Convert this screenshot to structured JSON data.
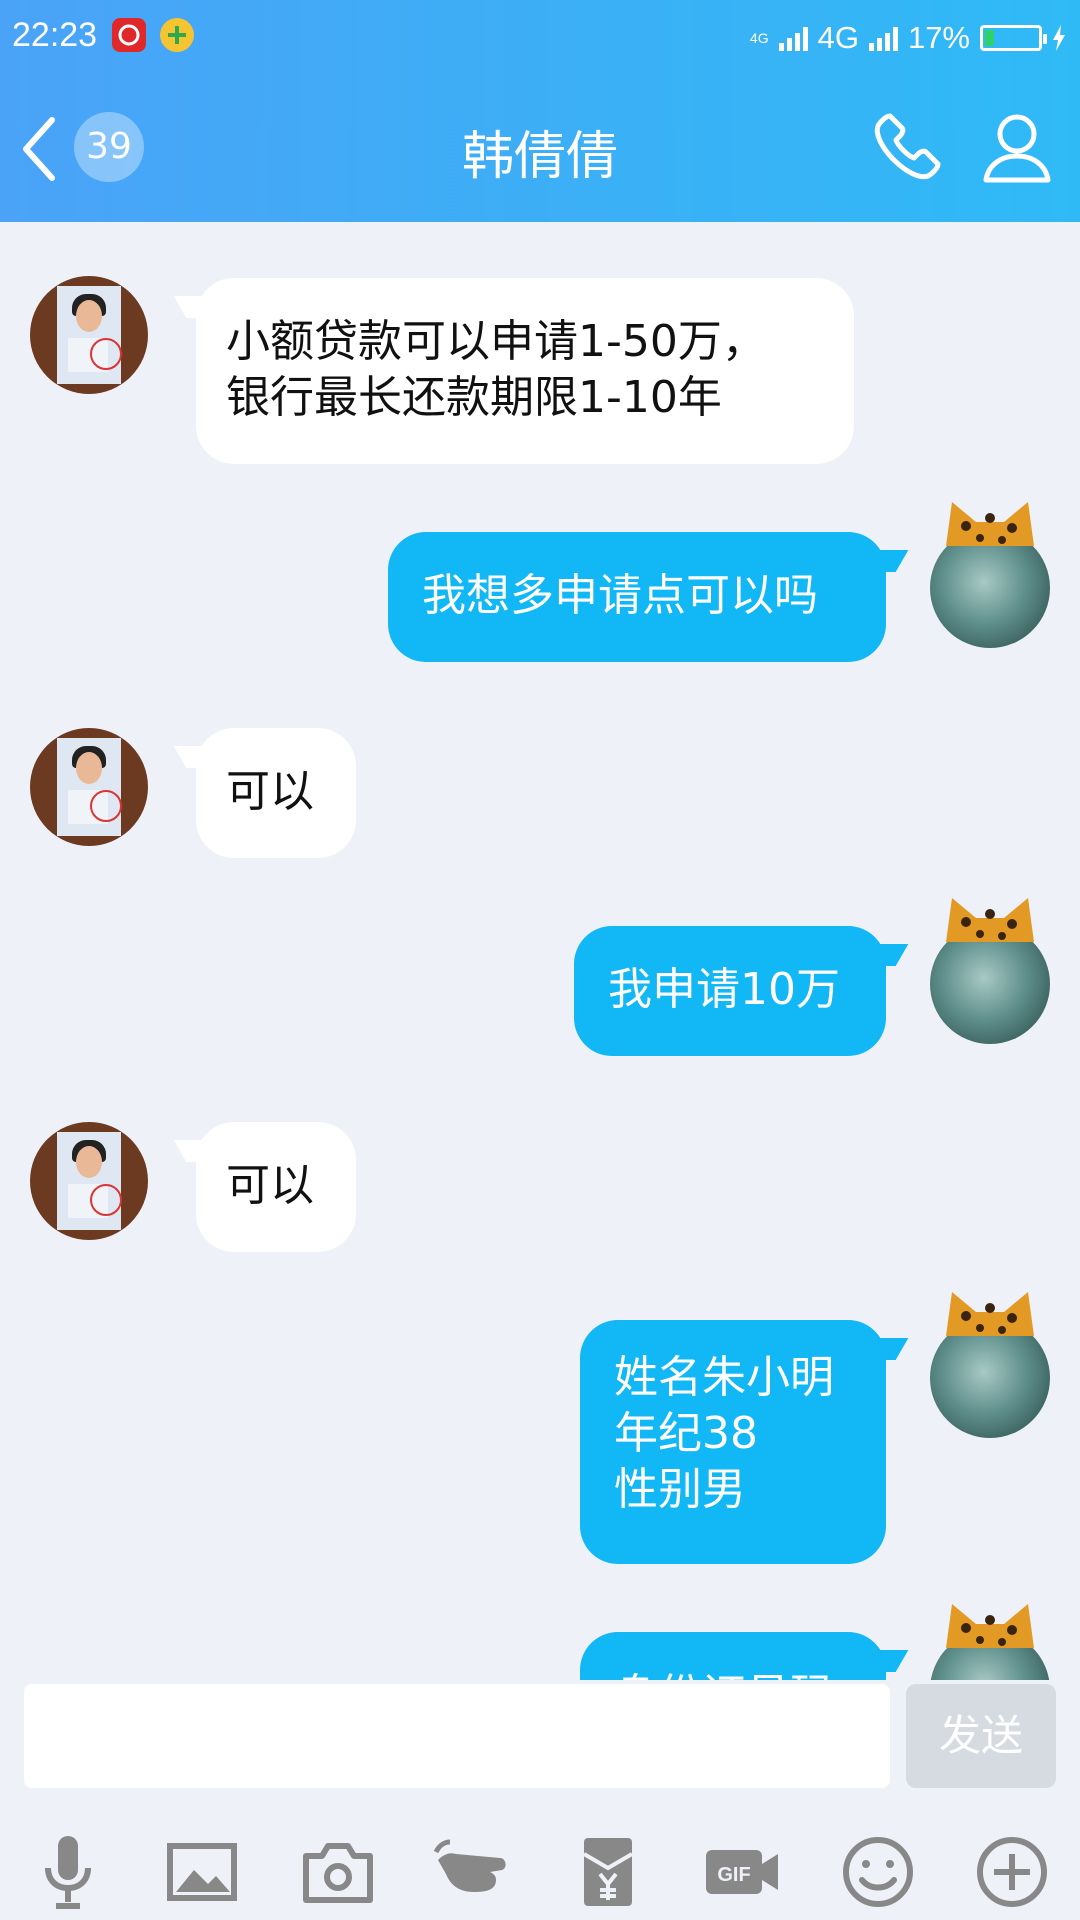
{
  "status_bar": {
    "time": "22:23",
    "network_small": "4G",
    "network": "4G",
    "battery_percent": "17%",
    "battery_level": 0.17
  },
  "nav": {
    "unread_count": "39",
    "title": "韩倩倩"
  },
  "messages": [
    {
      "side": "left",
      "lines": [
        "小额贷款可以申请1-50万，",
        "银行最长还款期限1-10年"
      ]
    },
    {
      "side": "right",
      "lines": [
        "我想多申请点可以吗"
      ]
    },
    {
      "side": "left",
      "lines": [
        "可以"
      ]
    },
    {
      "side": "right",
      "lines": [
        "我申请10万"
      ]
    },
    {
      "side": "left",
      "lines": [
        "可以"
      ]
    },
    {
      "side": "right",
      "lines": [
        "姓名朱小明",
        "年纪38",
        "性别男"
      ]
    },
    {
      "side": "right",
      "lines": [
        "身份证号码"
      ]
    }
  ],
  "input": {
    "value": "",
    "send_label": "发送"
  },
  "toolbar": [
    "microphone-icon",
    "image-icon",
    "camera-icon",
    "poke-icon",
    "red-envelope-icon",
    "gif-icon",
    "emoji-icon",
    "plus-icon"
  ],
  "colors": {
    "accent": "#12b7f5",
    "header_start": "#4aa3f7",
    "header_end": "#2fbaf6",
    "background": "#eef1f7"
  }
}
